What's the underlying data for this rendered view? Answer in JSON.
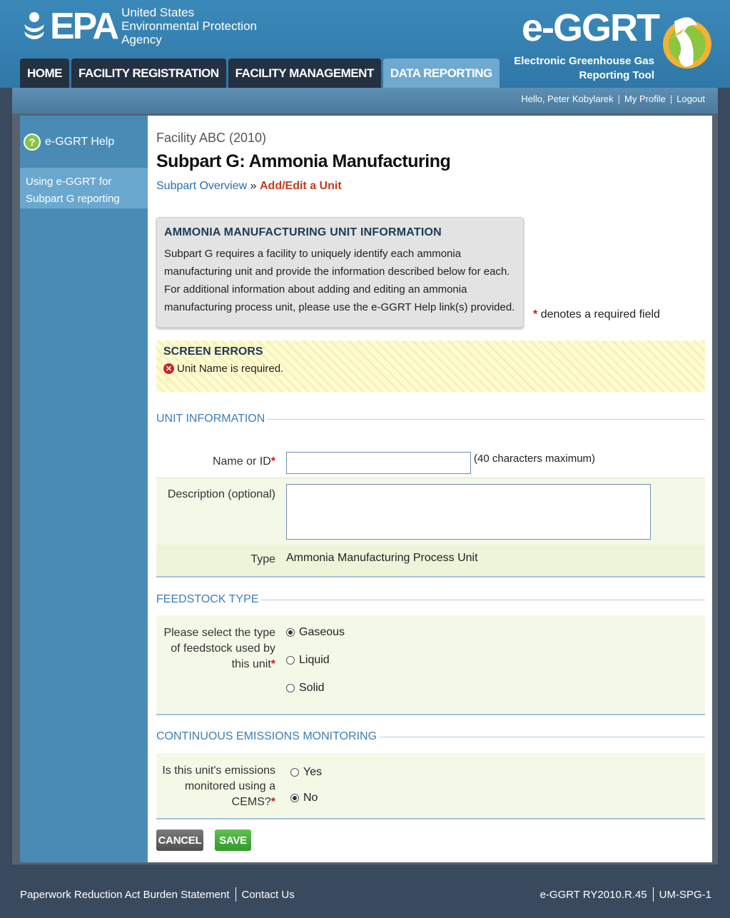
{
  "header": {
    "agency_lines": [
      "United States",
      "Environmental Protection",
      "Agency"
    ],
    "epa_letters": "EPA",
    "tabs": [
      {
        "label": "HOME",
        "active": false
      },
      {
        "label": "FACILITY REGISTRATION",
        "active": false
      },
      {
        "label": "FACILITY MANAGEMENT",
        "active": false
      },
      {
        "label": "DATA REPORTING",
        "active": true
      }
    ],
    "app_title": "e-GGRT",
    "app_subtitle_lines": [
      "Electronic Greenhouse Gas",
      "Reporting Tool"
    ]
  },
  "userbar": {
    "greeting": "Hello, Peter Kobylarek",
    "profile": "My Profile",
    "logout": "Logout",
    "sep": "|"
  },
  "sidebar": {
    "help": "e-GGRT Help",
    "link": "Using e-GGRT for Subpart G reporting"
  },
  "main": {
    "facility": "Facility ABC (2010)",
    "subpart_title": "Subpart G: Ammonia Manufacturing",
    "breadcrumb": {
      "link": "Subpart Overview",
      "sep": "»",
      "current": "Add/Edit a Unit"
    },
    "info": {
      "title": "AMMONIA MANUFACTURING UNIT INFORMATION",
      "body": "Subpart G requires a facility to uniquely identify each ammonia manufacturing unit and provide the information described below for each. For additional information about adding and editing an ammonia manufacturing process unit, please use the e-GGRT Help link(s) provided."
    },
    "required_note": "denotes a required field",
    "required_star": "*",
    "errors": {
      "title": "SCREEN ERRORS",
      "message": "Unit Name is required."
    },
    "unit_info": {
      "section": "UNIT INFORMATION",
      "name_label": "Name or ID",
      "name_value": "",
      "name_hint": "(40 characters maximum)",
      "desc_label": "Description (optional)",
      "desc_value": "",
      "type_label": "Type",
      "type_value": "Ammonia Manufacturing Process Unit"
    },
    "feedstock": {
      "section": "FEEDSTOCK TYPE",
      "label": "Please select the type of feedstock used by this unit",
      "options": [
        {
          "label": "Gaseous",
          "selected": true
        },
        {
          "label": "Liquid",
          "selected": false
        },
        {
          "label": "Solid",
          "selected": false
        }
      ]
    },
    "cems": {
      "section": "CONTINUOUS EMISSIONS MONITORING",
      "label": "Is this unit's emissions monitored using a CEMS?",
      "options": [
        {
          "label": "Yes",
          "selected": false
        },
        {
          "label": "No",
          "selected": true
        }
      ]
    },
    "buttons": {
      "cancel": "CANCEL",
      "save": "SAVE"
    }
  },
  "footer": {
    "paperwork": "Paperwork Reduction Act Burden Statement",
    "contact": "Contact Us",
    "version": "e-GGRT RY2010.R.45",
    "screen_id": "UM-SPG-1"
  },
  "colors": {
    "header": "#3b89b9",
    "active_tab": "#6fa9cf",
    "link": "#2a6eb0",
    "crumb_current": "#c23b1c",
    "required": "#d2181f"
  }
}
